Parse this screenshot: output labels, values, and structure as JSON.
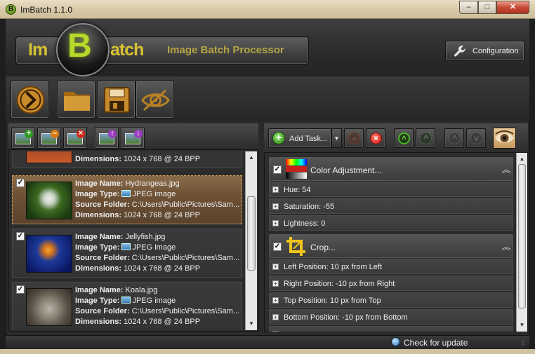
{
  "window": {
    "title": "ImBatch 1.1.0",
    "app_icon_letter": "B",
    "minimize": "–",
    "maximize": "□",
    "close": "✕"
  },
  "logo": {
    "left": "Im",
    "center": "B",
    "right": "atch",
    "subtitle": "Image Batch Processor"
  },
  "header": {
    "configuration_label": "Configuration"
  },
  "toolbar": {
    "icons": [
      "run-icon",
      "open-folder-icon",
      "save-icon",
      "preview-eye-icon"
    ]
  },
  "left_tools": {
    "icons": [
      "add-image-icon",
      "remove-image-icon",
      "clear-images-icon",
      "move-up-icon",
      "move-down-icon"
    ]
  },
  "image_list": {
    "labels": {
      "name": "Image Name:",
      "type": "Image Type:",
      "folder": "Source Folder:",
      "dims": "Dimensions:"
    },
    "items": [
      {
        "name": "",
        "type": "",
        "folder": "",
        "dims": "1024 x 768 @ 24 BPP",
        "partial": true,
        "checked": true
      },
      {
        "name": "Hydrangeas.jpg",
        "type": "JPEG image",
        "folder": "C:\\Users\\Public\\Pictures\\Sam...",
        "dims": "1024 x 768 @ 24 BPP",
        "checked": true,
        "selected": true
      },
      {
        "name": "Jellyfish.jpg",
        "type": "JPEG image",
        "folder": "C:\\Users\\Public\\Pictures\\Sam...",
        "dims": "1024 x 768 @ 24 BPP",
        "checked": true
      },
      {
        "name": "Koala.jpg",
        "type": "JPEG image",
        "folder": "C:\\Users\\Public\\Pictures\\Sam...",
        "dims": "1024 x 768 @ 24 BPP",
        "checked": true
      }
    ]
  },
  "right_tools": {
    "add_task_label": "Add Task...",
    "dropdown_arrow": "▼"
  },
  "tasks": [
    {
      "title": "Color Adjustment...",
      "checked": true,
      "props": [
        "Hue: 54",
        "Saturation: -55",
        "Lightness: 0"
      ]
    },
    {
      "title": "Crop...",
      "checked": true,
      "props": [
        "Left Position: 10 px from Left",
        "Right Position: -10 px from Right",
        "Top Position: 10 px from Top",
        "Bottom Position: -10 px from Bottom"
      ]
    }
  ],
  "status": {
    "check_update": "Check for update"
  },
  "colors": {
    "logo_yellow": "#d8c231",
    "logo_green": "#b7d92b",
    "subtitle": "#b5a544",
    "selected_card": "#8a6a48",
    "close_red": "#c74a35"
  }
}
